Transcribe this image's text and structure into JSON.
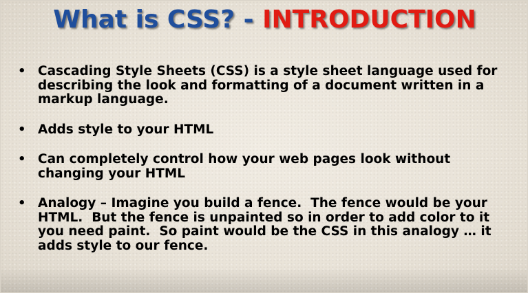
{
  "slide": {
    "title": {
      "part1": "What is CSS?",
      "part2": " - ",
      "part3": "INTRODUCTION"
    },
    "bullet_symbol": "•",
    "bullets": [
      {
        "text": "Cascading Style Sheets (CSS) is a style sheet language used for describing the look and formatting of a document written in a markup language."
      },
      {
        "text": "Adds style to your HTML"
      },
      {
        "text": "Can completely control how your web pages look without changing your HTML"
      },
      {
        "text": "Analogy – Imagine you build a fence.  The fence would be your HTML.  But the fence is unpainted so in order to add color to it you need paint.  So paint would be the CSS in this analogy … it adds style to our fence."
      }
    ]
  },
  "colors": {
    "title_blue": "#1f4e9c",
    "title_red": "#e11b13",
    "background": "#ece6dc"
  }
}
